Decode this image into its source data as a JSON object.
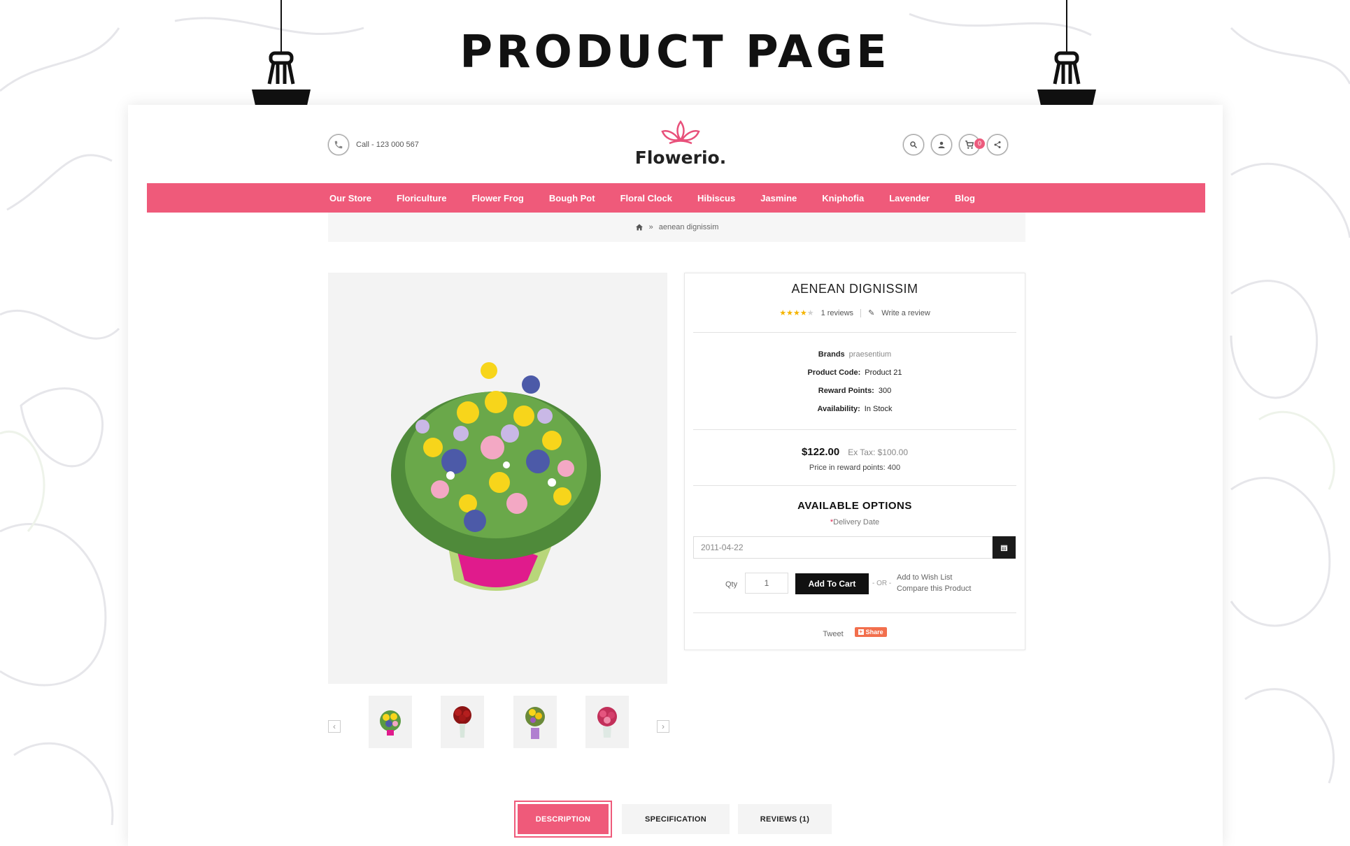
{
  "page_heading": "PRODUCT PAGE",
  "header": {
    "call_text": "Call - 123 000 567",
    "logo_text": "Flowerio.",
    "cart_count": "0",
    "icons": [
      "phone-icon",
      "search-icon",
      "user-icon",
      "cart-icon",
      "share-icon"
    ]
  },
  "nav": {
    "items": [
      "Our Store",
      "Floriculture",
      "Flower Frog",
      "Bough Pot",
      "Floral Clock",
      "Hibiscus",
      "Jasmine",
      "Kniphofia",
      "Lavender",
      "Blog"
    ]
  },
  "breadcrumb": {
    "separator": "»",
    "current": "aenean dignissim"
  },
  "product": {
    "title": "AENEAN DIGNISSIM",
    "rating": 4,
    "rating_max": 5,
    "reviews_text": "1 reviews",
    "write_review": "Write a review",
    "specs": [
      {
        "label": "Brands",
        "value": "praesentium"
      },
      {
        "label": "Product Code:",
        "value": "Product 21"
      },
      {
        "label": "Reward Points:",
        "value": "300"
      },
      {
        "label": "Availability:",
        "value": "In Stock"
      }
    ],
    "price": "$122.00",
    "ex_tax": "Ex Tax: $100.00",
    "reward_price": "Price in reward points: 400",
    "options_title": "AVAILABLE OPTIONS",
    "delivery_required": "*",
    "delivery_label": "Delivery Date",
    "delivery_value": "2011-04-22",
    "qty_label": "Qty",
    "qty_value": "1",
    "add_to_cart": "Add To Cart",
    "or_text": "- OR -",
    "wish_list": "Add to Wish List",
    "compare": "Compare this Product",
    "tweet": "Tweet",
    "share": "Share"
  },
  "gallery": {
    "prev": "‹",
    "next": "›"
  },
  "tabs": [
    "DESCRIPTION",
    "SPECIFICATION",
    "REVIEWS (1)"
  ],
  "colors": {
    "accent": "#ef5a7a",
    "dark": "#111111",
    "star": "#f5b400",
    "share": "#f26f4d"
  }
}
